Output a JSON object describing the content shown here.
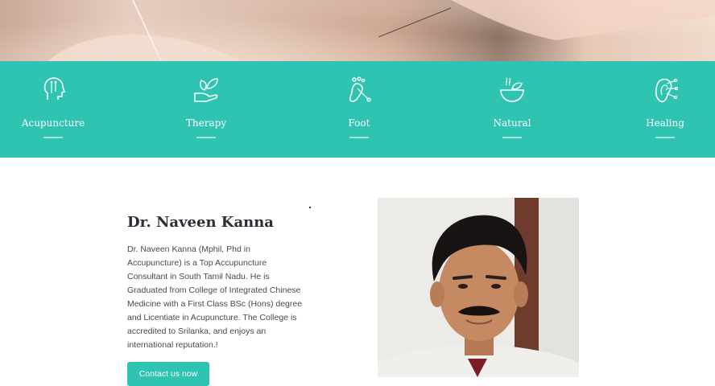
{
  "features": [
    {
      "label": "Acupuncture",
      "icon": "head-acupuncture-icon"
    },
    {
      "label": "Therapy",
      "icon": "hand-leaf-icon"
    },
    {
      "label": "Foot",
      "icon": "foot-reflexology-icon"
    },
    {
      "label": "Natural",
      "icon": "herbal-bowl-icon"
    },
    {
      "label": "Healing",
      "icon": "ear-points-icon"
    }
  ],
  "about": {
    "title": "Dr. Naveen Kanna",
    "description": "Dr. Naveen Kanna (Mphil, Phd in Accupuncture) is a Top Accupuncture Consultant in South Tamil Nadu. He is Graduated from College of Integrated Chinese Medicine with a First Class BSc (Hons) degree and Licentiate in Acupuncture. The College is accredited to Srilanka, and enjoys an international reputation.!",
    "button_label": "Contact us now"
  },
  "colors": {
    "accent": "#2fc4b2",
    "heading": "#2a2f36",
    "body_text": "#4a4a4a"
  }
}
